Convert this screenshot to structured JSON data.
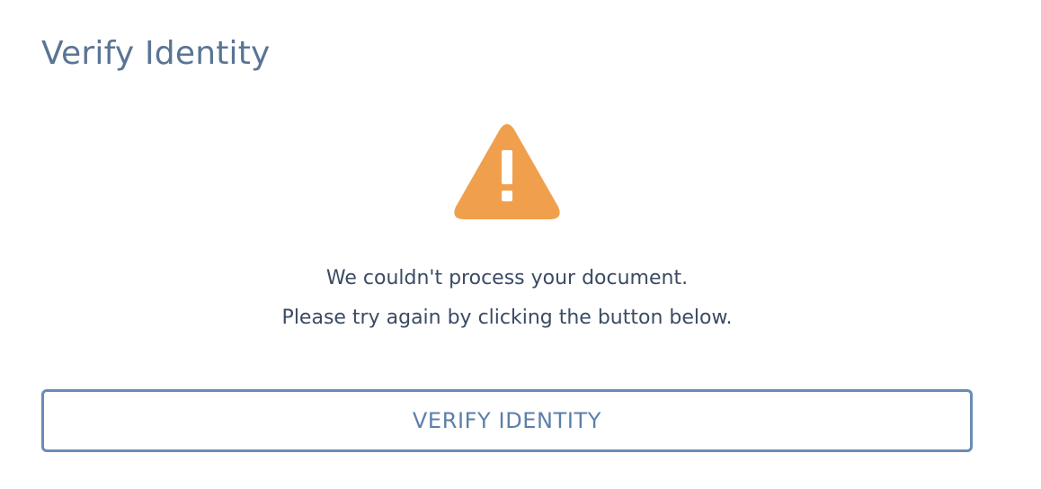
{
  "page": {
    "title": "Verify Identity"
  },
  "alert": {
    "icon": "warning-icon",
    "icon_color": "#f0a04c",
    "message_line_1": "We couldn't process your document.",
    "message_line_2": "Please try again by clicking the button below."
  },
  "actions": {
    "verify_label": "VERIFY IDENTITY"
  }
}
